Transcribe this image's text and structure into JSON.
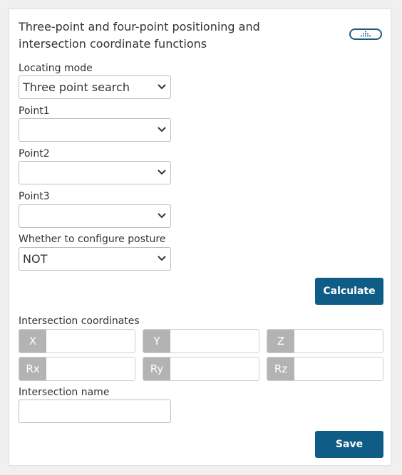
{
  "panel": {
    "title": "Three-point and four-point positioning and intersection coordinate functions"
  },
  "form": {
    "locating_mode": {
      "label": "Locating mode",
      "value": "Three point search"
    },
    "point1": {
      "label": "Point1",
      "value": ""
    },
    "point2": {
      "label": "Point2",
      "value": ""
    },
    "point3": {
      "label": "Point3",
      "value": ""
    },
    "posture": {
      "label": "Whether to configure posture",
      "value": "NOT"
    }
  },
  "buttons": {
    "calculate": "Calculate",
    "save": "Save"
  },
  "intersection": {
    "label": "Intersection coordinates",
    "fields": [
      {
        "tag": "X",
        "value": ""
      },
      {
        "tag": "Y",
        "value": ""
      },
      {
        "tag": "Z",
        "value": ""
      },
      {
        "tag": "Rx",
        "value": ""
      },
      {
        "tag": "Ry",
        "value": ""
      },
      {
        "tag": "Rz",
        "value": ""
      }
    ],
    "name_label": "Intersection name",
    "name_value": ""
  },
  "colors": {
    "accent": "#0f5d86",
    "tag_bg": "#b3b3b3"
  },
  "icons": {
    "toggle": "dots-triangle-icon",
    "select_arrow": "chevron-down-icon"
  }
}
